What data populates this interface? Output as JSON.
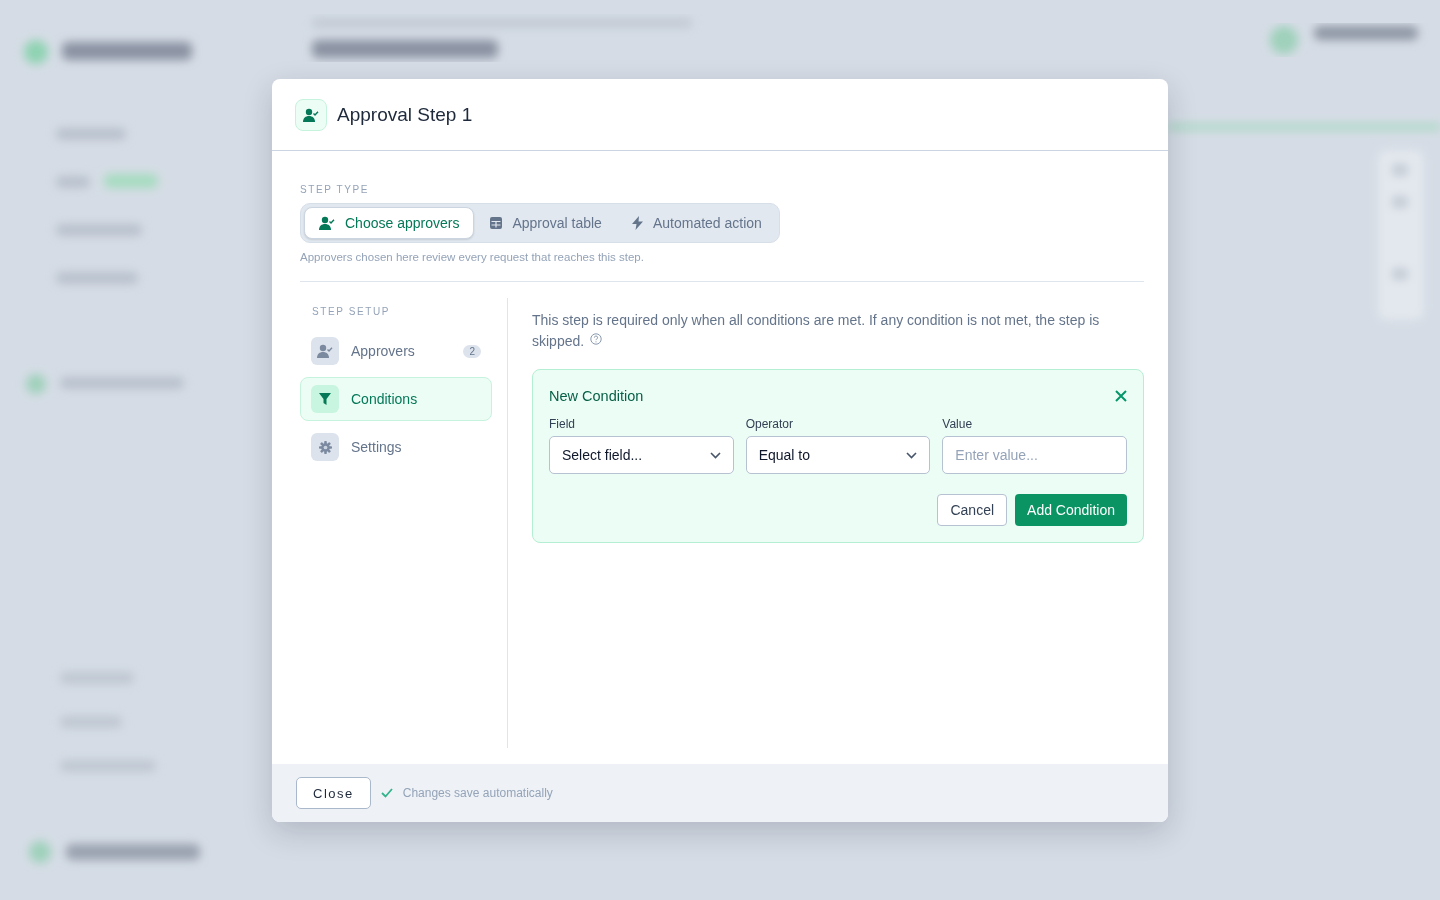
{
  "dialog": {
    "title": "Approval Step 1"
  },
  "step_type": {
    "label": "STEP TYPE",
    "options": [
      {
        "label": "Choose approvers",
        "selected": true
      },
      {
        "label": "Approval table",
        "selected": false
      },
      {
        "label": "Automated action",
        "selected": false
      }
    ],
    "hint": "Approvers chosen here review every request that reaches this step."
  },
  "step_setup": {
    "label": "STEP SETUP",
    "items": [
      {
        "label": "Approvers",
        "badge": "2",
        "selected": false
      },
      {
        "label": "Conditions",
        "selected": true
      },
      {
        "label": "Settings",
        "selected": false
      }
    ]
  },
  "conditions": {
    "description": "This step is required only when all conditions are met. If any condition is not met, the step is skipped.",
    "new_condition": {
      "title": "New Condition",
      "fields": [
        {
          "kind": "select",
          "label": "Field",
          "value": "Select field..."
        },
        {
          "kind": "select",
          "label": "Operator",
          "value": "Equal to"
        },
        {
          "kind": "text",
          "label": "Value",
          "placeholder": "Enter value..."
        }
      ],
      "buttons": [
        {
          "label": "Cancel",
          "kind": "secondary"
        },
        {
          "label": "Add Condition",
          "kind": "primary"
        }
      ]
    }
  },
  "footer": {
    "button": "Close",
    "status": "Changes save automatically"
  }
}
